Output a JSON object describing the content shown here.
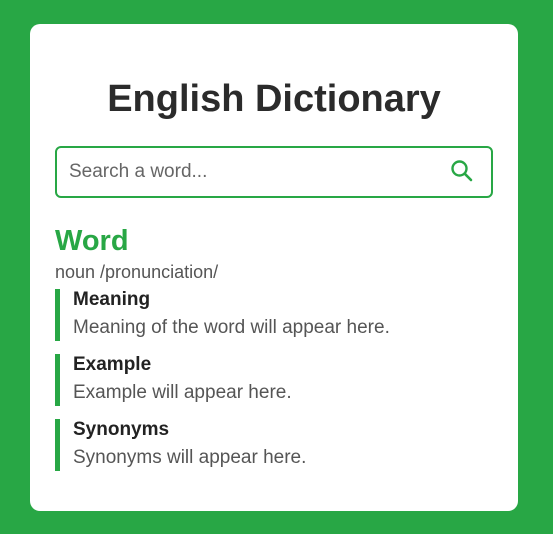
{
  "app": {
    "title": "English Dictionary"
  },
  "search": {
    "placeholder": "Search a word...",
    "value": "",
    "icon": "search-icon"
  },
  "result": {
    "word": "Word",
    "phonetic": "noun /pronunciation/",
    "sections": [
      {
        "title": "Meaning",
        "text": "Meaning of the word will appear here."
      },
      {
        "title": "Example",
        "text": "Example will appear here."
      },
      {
        "title": "Synonyms",
        "text": "Synonyms will appear here."
      }
    ]
  },
  "colors": {
    "accent": "#28a745",
    "background": "#28a745",
    "card": "#ffffff",
    "title": "#2b2b2b",
    "text_muted": "#555555"
  }
}
